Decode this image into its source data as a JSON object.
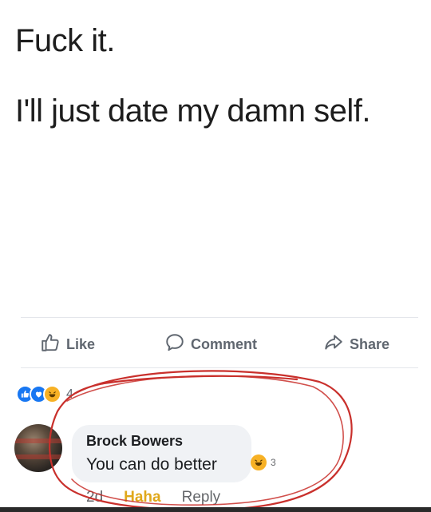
{
  "post": {
    "line1": "Fuck it.",
    "line2": "I'll just date my damn self."
  },
  "actions": {
    "like": "Like",
    "comment": "Comment",
    "share": "Share"
  },
  "reactions": {
    "icons": [
      "like-icon",
      "love-icon",
      "haha-icon"
    ],
    "count": "4"
  },
  "comment": {
    "author": "Brock Bowers",
    "text": "You can do better",
    "reaction_icon": "haha-icon",
    "reaction_count": "3",
    "time": "2d",
    "reaction_label": "Haha",
    "reply_label": "Reply"
  },
  "colors": {
    "accent_blue": "#1877f2",
    "haha_yellow": "#f7b125",
    "annotation_red": "#c9302c",
    "muted_text": "#65676b"
  }
}
